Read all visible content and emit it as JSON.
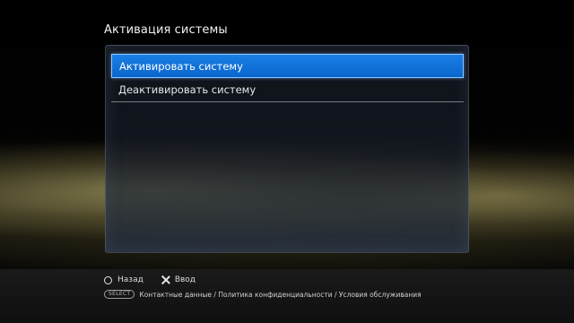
{
  "screen": {
    "title": "Активация системы"
  },
  "menu": {
    "items": [
      {
        "label": "Активировать систему",
        "selected": true
      },
      {
        "label": "Деактивировать систему",
        "selected": false
      }
    ]
  },
  "hints": {
    "back_label": "Назад",
    "back_icon": "circle-icon",
    "enter_label": "Ввод",
    "enter_icon": "cross-icon"
  },
  "footer": {
    "select_badge": "SELECT",
    "links_text": "Контактные данные / Политика конфиденциальности / Условия обслуживания"
  },
  "colors": {
    "selection": "#0a66cc",
    "selection_border": "#8fc6ff"
  }
}
